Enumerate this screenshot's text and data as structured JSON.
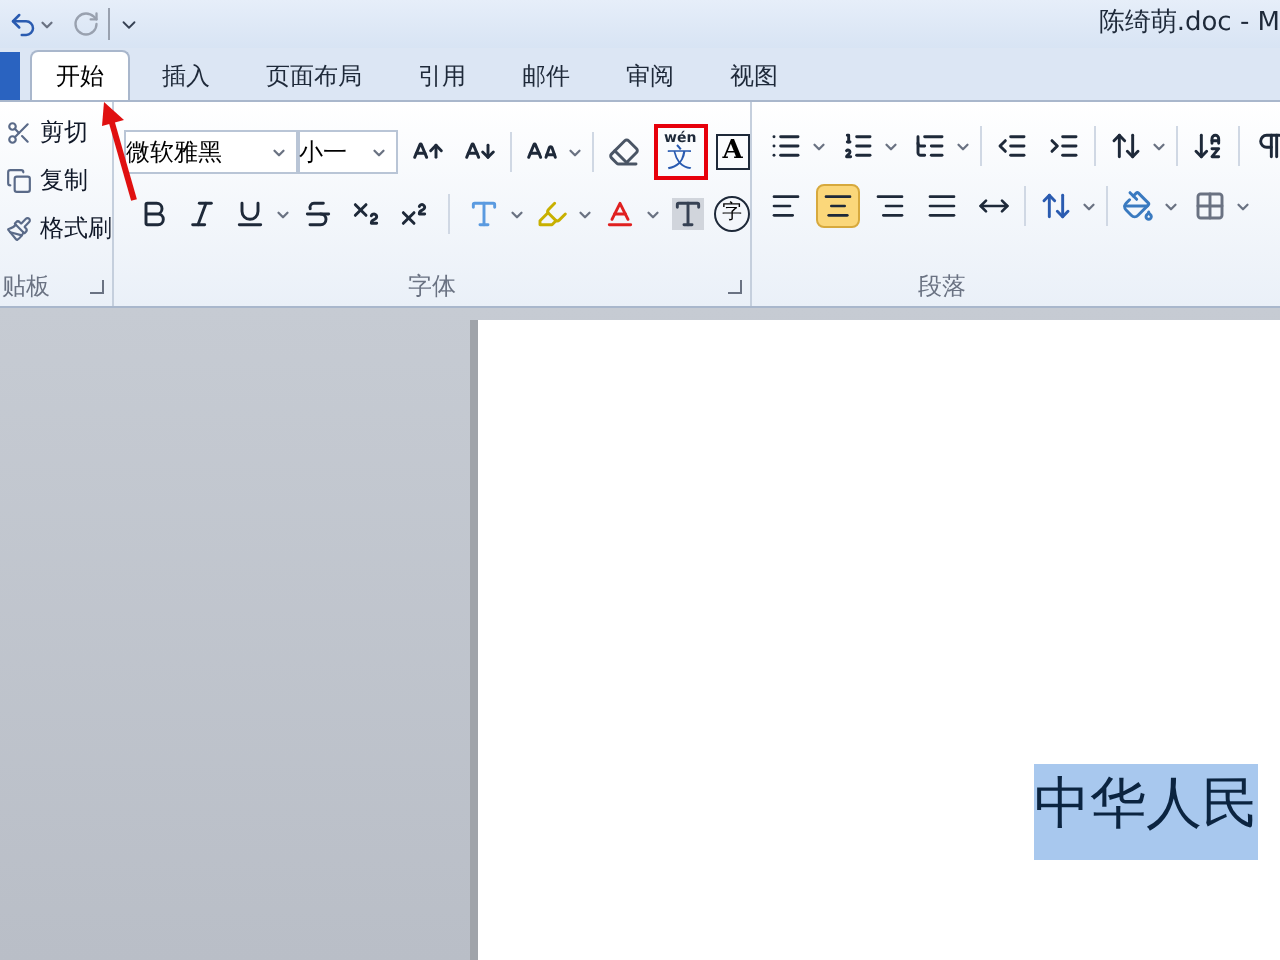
{
  "title": "陈绮萌.doc - M",
  "tabs": [
    {
      "label": "开始",
      "selected": true
    },
    {
      "label": "插入",
      "selected": false
    },
    {
      "label": "页面布局",
      "selected": false
    },
    {
      "label": "引用",
      "selected": false
    },
    {
      "label": "邮件",
      "selected": false
    },
    {
      "label": "审阅",
      "selected": false
    },
    {
      "label": "视图",
      "selected": false
    }
  ],
  "clipboard": {
    "items": [
      {
        "kind": "cut",
        "label": "剪切"
      },
      {
        "kind": "copy",
        "label": "复制"
      },
      {
        "kind": "painter",
        "label": "格式刷"
      }
    ],
    "group_label": "贴板"
  },
  "font": {
    "name": "微软雅黑",
    "size": "小一",
    "group_label": "字体",
    "phonetic": {
      "top": "wén",
      "label": "文",
      "annotated": true
    },
    "border_char": "A",
    "enclose_char": "字"
  },
  "paragraph": {
    "group_label": "段落",
    "alignments": [
      {
        "kind": "left",
        "selected": false
      },
      {
        "kind": "center",
        "selected": true
      },
      {
        "kind": "right",
        "selected": false
      },
      {
        "kind": "justify",
        "selected": false
      },
      {
        "kind": "distributed",
        "selected": false
      }
    ]
  },
  "document": {
    "text": "中华人民",
    "selected": true
  }
}
